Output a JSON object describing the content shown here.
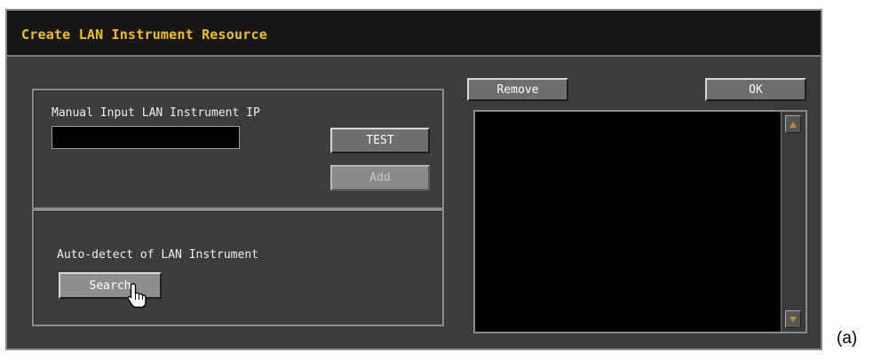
{
  "dialog": {
    "title": "Create LAN Instrument Resource"
  },
  "manual": {
    "label": "Manual Input LAN Instrument IP",
    "ip_value": "",
    "test_label": "TEST",
    "add_label": "Add"
  },
  "auto": {
    "label": "Auto-detect of LAN Instrument",
    "search_label": "Search"
  },
  "resources": {
    "remove_label": "Remove",
    "ok_label": "OK",
    "items": []
  },
  "figure": {
    "caption": "(a)"
  },
  "colors": {
    "title": "#f2c200",
    "background": "#3c3c3c",
    "titlebar": "#161616",
    "scroll_arrow": "#c08a2a"
  },
  "icons": {
    "cursor": "hand-pointer-icon",
    "scroll_up": "scroll-up-arrow-icon",
    "scroll_down": "scroll-down-arrow-icon"
  }
}
